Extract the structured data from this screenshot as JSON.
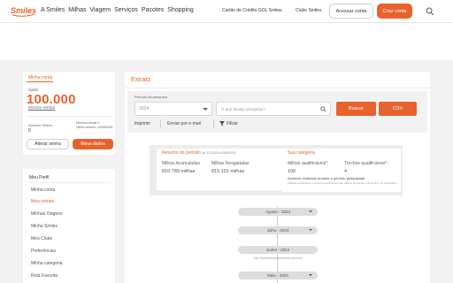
{
  "header": {
    "logo_text": "Smiles",
    "nav": [
      "A Smiles",
      "Milhas",
      "Viagem",
      "Serviços",
      "Pacotes",
      "Shopping"
    ],
    "link_card": "Cartão de Crédito GOL Smiles",
    "link_club": "Clube Smiles",
    "login_button": "Acessar conta",
    "create_button": "Criar conta",
    "search_icon": "search-icon"
  },
  "account": {
    "tab": "Minha conta",
    "saldo_label": "Saldo",
    "balance": "100.000",
    "show_statement": "Mostrar extrato",
    "number_label": "Número Smiles",
    "number_value": "0",
    "member_since": "Membro desde 0",
    "last_access": "Último acesso: 18/09/2024",
    "change_password": "Alterar senha",
    "my_data": "Meus dados"
  },
  "menu": {
    "title": "Meu Perfil",
    "items": [
      "Minha conta",
      "Meu extrato",
      "Minhas Viagens",
      "Minha Smiles",
      "Meu Clube",
      "Preferências",
      "Minha categoria",
      "Rota Favorita"
    ],
    "active_index": 1
  },
  "main": {
    "title": "Extrato",
    "period_label": "Período da pesquisa",
    "year_value": "2024",
    "search_placeholder": "O que deseja pesquisar?",
    "search_button": "Buscar",
    "csv_button": "CSV",
    "print": "Imprimir",
    "email": "Enviar por e-mail",
    "filter": "Filtrar"
  },
  "summary": {
    "title": "Resumo do período",
    "period": "de 1/1/2024 a 18/9/2024",
    "acc_label": "Milhas Acumuladas",
    "acc_value": "810.789 milhas",
    "red_label": "Milhas Resgatadas",
    "red_value": "815.101 milhas",
    "cat_title": "Sua categoria",
    "qual_label": "Milhas qualificáveis*:",
    "qual_value": "100",
    "trechos_label": "Trechos qualificáveis*:",
    "trechos_value": "4",
    "note": "Acúmulo realizado durante o período pesquisado.",
    "small_note": "*Milhas qualificáveis e trechos qualificáveis são válidos de janeiro a dezembro do calendário."
  },
  "timeline": {
    "months": [
      "Agosto - 2024",
      "Julho - 2024",
      "Junho - 2024",
      "Maio - 2024"
    ],
    "empty_text": "Não há lançamentos nesse período"
  },
  "colors": {
    "accent": "#e8622c"
  }
}
